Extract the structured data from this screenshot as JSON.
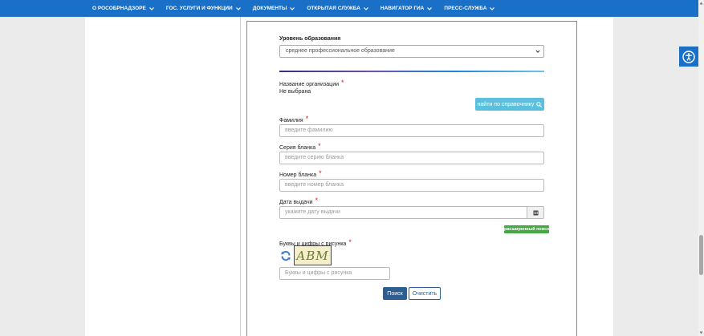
{
  "nav": {
    "items": [
      {
        "label": "О РОСОБРНАДЗОРЕ"
      },
      {
        "label": "ГОС. УСЛУГИ И ФУНКЦИИ"
      },
      {
        "label": "ДОКУМЕНТЫ"
      },
      {
        "label": "ОТКРЫТАЯ СЛУЖБА"
      },
      {
        "label": "НАВИГАТОР ГИА"
      },
      {
        "label": "ПРЕСС-СЛУЖБА"
      }
    ]
  },
  "form": {
    "education_level": {
      "label": "Уровень образования",
      "selected": "среднее профессиональное образование"
    },
    "organization": {
      "label": "Название организации",
      "value": "Не выбрана",
      "find_button": "найти по справочнику"
    },
    "surname": {
      "label": "Фамилия",
      "placeholder": "введите фамилию"
    },
    "series": {
      "label": "Серия бланка",
      "placeholder": "введите серию бланка"
    },
    "number": {
      "label": "Номер бланка",
      "placeholder": "введите номер бланка"
    },
    "issue_date": {
      "label": "Дата выдачи",
      "placeholder": "укажите дату выдачи"
    },
    "advanced_search": "расширенный поиск",
    "captcha": {
      "label": "Буквы и цифры с рисунка",
      "image_text": "ABM",
      "placeholder": "Буквы и цифры с рисунка"
    },
    "required_mark": "*",
    "search_button": "Поиск",
    "clear_button": "Очистить"
  },
  "colors": {
    "nav_bg": "#1a6fc7",
    "required": "#d21f1f",
    "find_button": "#5bc0de",
    "advanced_badge": "#45a845",
    "primary_button": "#2c5f8f"
  }
}
